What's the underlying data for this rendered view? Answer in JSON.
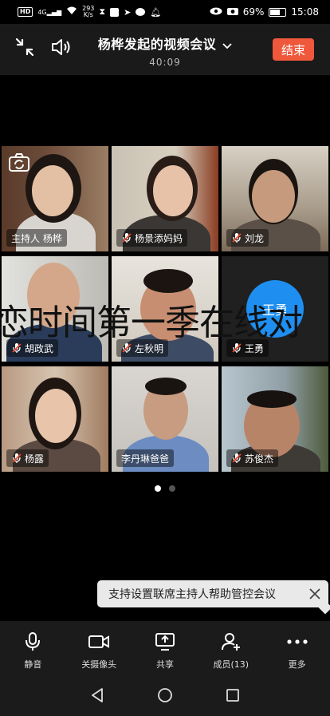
{
  "status_bar": {
    "network_badge": "HD",
    "signal_label": "4G",
    "speed_value": "293",
    "speed_unit": "K/s",
    "battery_percent": "69%",
    "battery_level": 0.69,
    "time": "15:08"
  },
  "header": {
    "title": "杨桦发起的视频会议",
    "duration": "40:09",
    "end_button": "结束"
  },
  "participants": [
    {
      "name": "主持人  杨桦",
      "muted": false
    },
    {
      "name": "杨景添妈妈",
      "muted": true
    },
    {
      "name": "刘龙",
      "muted": true
    },
    {
      "name": "胡政武",
      "muted": true
    },
    {
      "name": "左秋明",
      "muted": true
    },
    {
      "name": "王勇",
      "muted": true,
      "avatar_text": "王勇"
    },
    {
      "name": "杨露",
      "muted": true
    },
    {
      "name": "李丹琳爸爸",
      "muted": false
    },
    {
      "name": "苏俊杰",
      "muted": true
    }
  ],
  "overlay_text": "恋时间第一季在线对",
  "pagination": {
    "count": 2,
    "active": 0
  },
  "tooltip": {
    "text": "支持设置联席主持人帮助管控会议"
  },
  "toolbar": {
    "mute": "静音",
    "camera": "关摄像头",
    "share": "共享",
    "members": "成员(13)",
    "more": "更多"
  },
  "colors": {
    "end_button": "#f0583c",
    "avatar": "#1e8ff0",
    "muted_mic": "#e8452c"
  }
}
